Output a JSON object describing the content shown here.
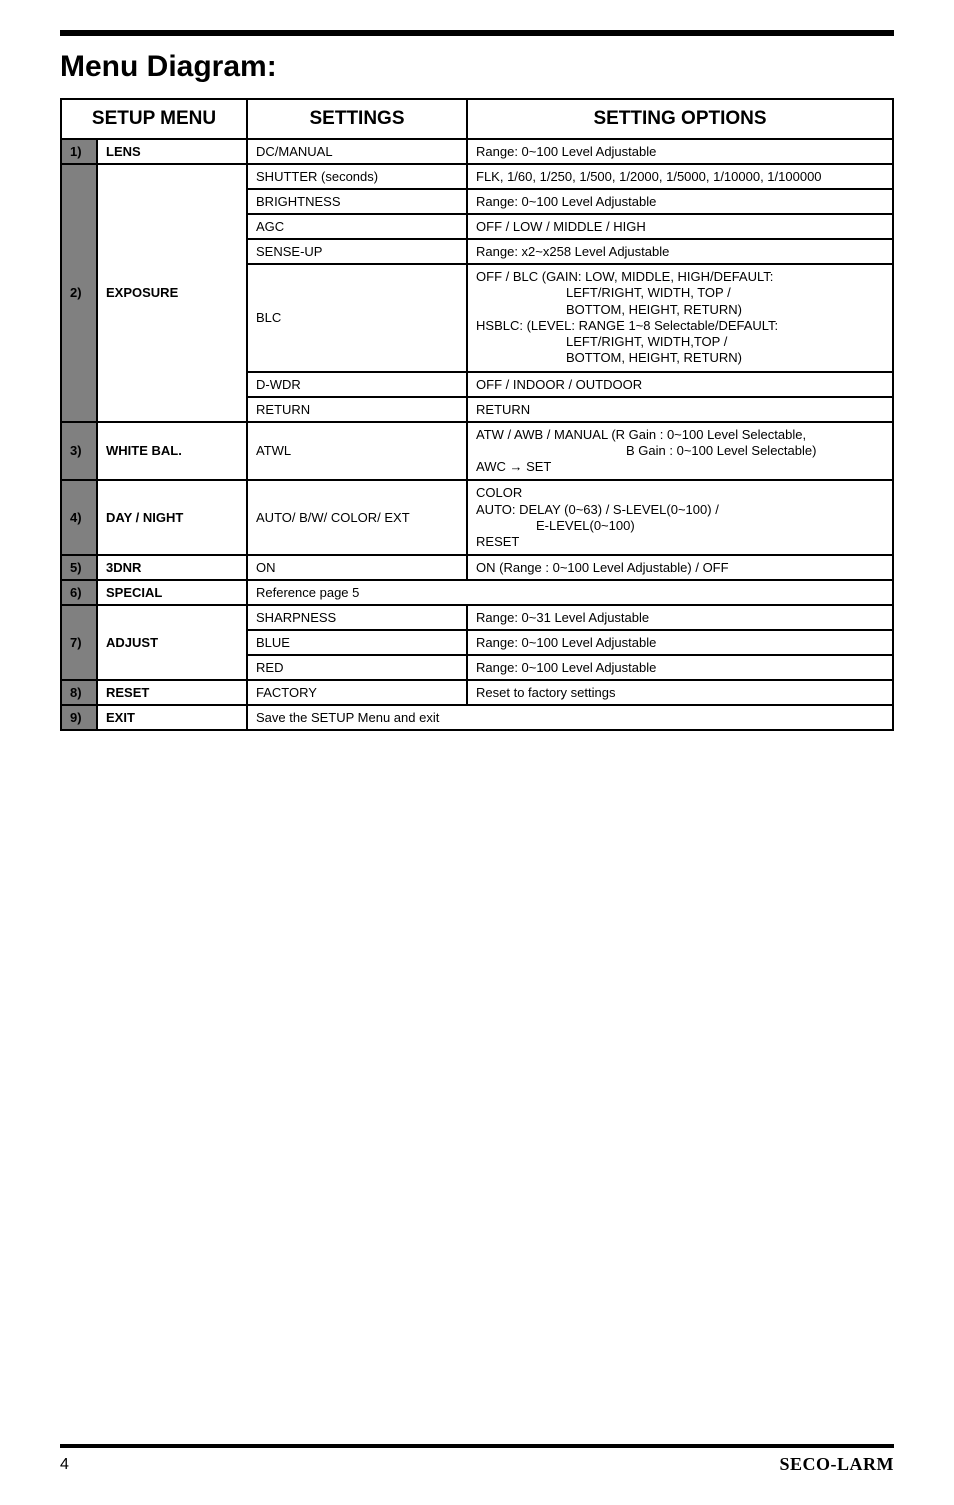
{
  "title": "Menu Diagram:",
  "headers": {
    "c1": "SETUP MENU",
    "c2": "SETTINGS",
    "c3": "SETTING OPTIONS"
  },
  "rows": {
    "lens": {
      "num": "1)",
      "label": "LENS",
      "setting": "DC/MANUAL",
      "option": "Range: 0~100 Level Adjustable"
    },
    "exposure": {
      "num": "2)",
      "label": "EXPOSURE",
      "r1s": "SHUTTER (seconds)",
      "r1o": "FLK, 1/60, 1/250, 1/500, 1/2000, 1/5000, 1/10000, 1/100000",
      "r2s": "BRIGHTNESS",
      "r2o": "Range: 0~100 Level Adjustable",
      "r3s": "AGC",
      "r3o": "OFF / LOW / MIDDLE / HIGH",
      "r4s": "SENSE-UP",
      "r4o": "Range: x2~x258 Level Adjustable",
      "r5s": "BLC",
      "r5o_l1": "OFF / BLC (GAIN: LOW, MIDDLE, HIGH/DEFAULT:",
      "r5o_l2": "LEFT/RIGHT, WIDTH, TOP /",
      "r5o_l3": "BOTTOM, HEIGHT, RETURN)",
      "r5o_l4": "HSBLC: (LEVEL: RANGE 1~8 Selectable/DEFAULT:",
      "r5o_l5": "LEFT/RIGHT, WIDTH,TOP /",
      "r5o_l6": "BOTTOM, HEIGHT, RETURN)",
      "r6s": "D-WDR",
      "r6o": "OFF / INDOOR / OUTDOOR",
      "r7s": "RETURN",
      "r7o": "RETURN"
    },
    "whitebal": {
      "num": "3)",
      "label": "WHITE BAL.",
      "setting": "ATWL",
      "o_l1": "ATW / AWB / MANUAL (R Gain : 0~100 Level Selectable,",
      "o_l2": "B Gain : 0~100 Level Selectable)",
      "o_l3": "AWC → SET"
    },
    "daynight": {
      "num": "4)",
      "label": "DAY / NIGHT",
      "setting": "AUTO/ B/W/ COLOR/ EXT",
      "o_l1": "COLOR",
      "o_l2": "AUTO: DELAY (0~63) / S-LEVEL(0~100) /",
      "o_l3": "E-LEVEL(0~100)",
      "o_l4": "RESET"
    },
    "dnr": {
      "num": "5)",
      "label": "3DNR",
      "setting": "ON",
      "option": "ON (Range : 0~100 Level Adjustable) / OFF"
    },
    "special": {
      "num": "6)",
      "label": "SPECIAL",
      "setting": "Reference page 5"
    },
    "adjust": {
      "num": "7)",
      "label": "ADJUST",
      "r1s": "SHARPNESS",
      "r1o": "Range: 0~31 Level Adjustable",
      "r2s": "BLUE",
      "r2o": "Range: 0~100 Level Adjustable",
      "r3s": "RED",
      "r3o": "Range: 0~100 Level Adjustable"
    },
    "reset": {
      "num": "8)",
      "label": "RESET",
      "setting": "FACTORY",
      "option": "Reset to factory settings"
    },
    "exit": {
      "num": "9)",
      "label": "EXIT",
      "setting": "Save the SETUP Menu and exit"
    }
  },
  "footer": {
    "page": "4",
    "brand": "SECO-LARM"
  }
}
